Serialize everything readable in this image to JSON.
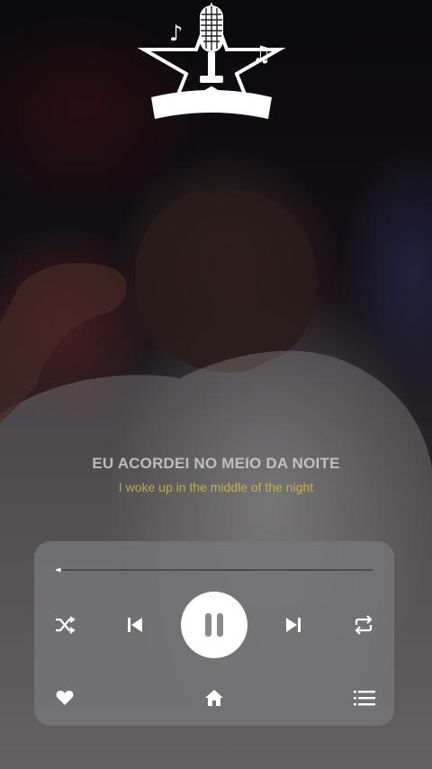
{
  "lyrics": {
    "current_line": "EU ACORDEI NO MEIO DA NOITE",
    "translation": "I woke up in the middle of the night"
  },
  "player": {
    "progress": 0.01,
    "state": "playing"
  },
  "icons": {
    "logo": "microphone-star-banner-logo",
    "shuffle": "shuffle-icon",
    "previous": "skip-previous-icon",
    "pause": "pause-icon",
    "next": "skip-next-icon",
    "repeat": "repeat-icon",
    "like": "heart-icon",
    "home": "home-icon",
    "queue": "queue-list-icon"
  },
  "colors": {
    "lyric_main": "#cfcfcf",
    "lyric_translation": "#d6c23a",
    "panel": "#78787c"
  }
}
